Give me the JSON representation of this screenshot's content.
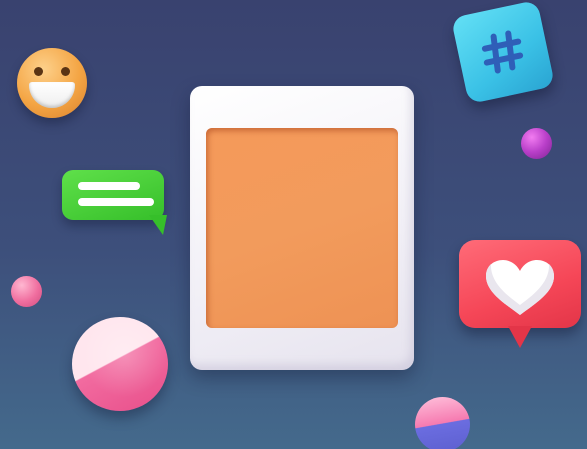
{
  "scene": {
    "background_top": "#39426f",
    "background_bottom": "#446a8c"
  },
  "frame": {
    "border_color": "#f5f3f8",
    "photo_color": "#f29b5c"
  },
  "icons": [
    {
      "name": "smiley-emoji-icon",
      "color": "#f4a544"
    },
    {
      "name": "chat-bubble-icon",
      "color": "#3ccb2d"
    },
    {
      "name": "hashtag-icon",
      "color": "#3ac1e6"
    },
    {
      "name": "heart-like-icon",
      "color": "#f54657"
    }
  ],
  "decorations": [
    {
      "name": "purple-sphere",
      "color": "#b93fc9"
    },
    {
      "name": "pink-sphere",
      "color": "#f06e9f"
    },
    {
      "name": "pink-white-sphere",
      "color": "#e84f8a"
    },
    {
      "name": "pink-blue-sphere",
      "color": "#5d5fcf"
    }
  ]
}
